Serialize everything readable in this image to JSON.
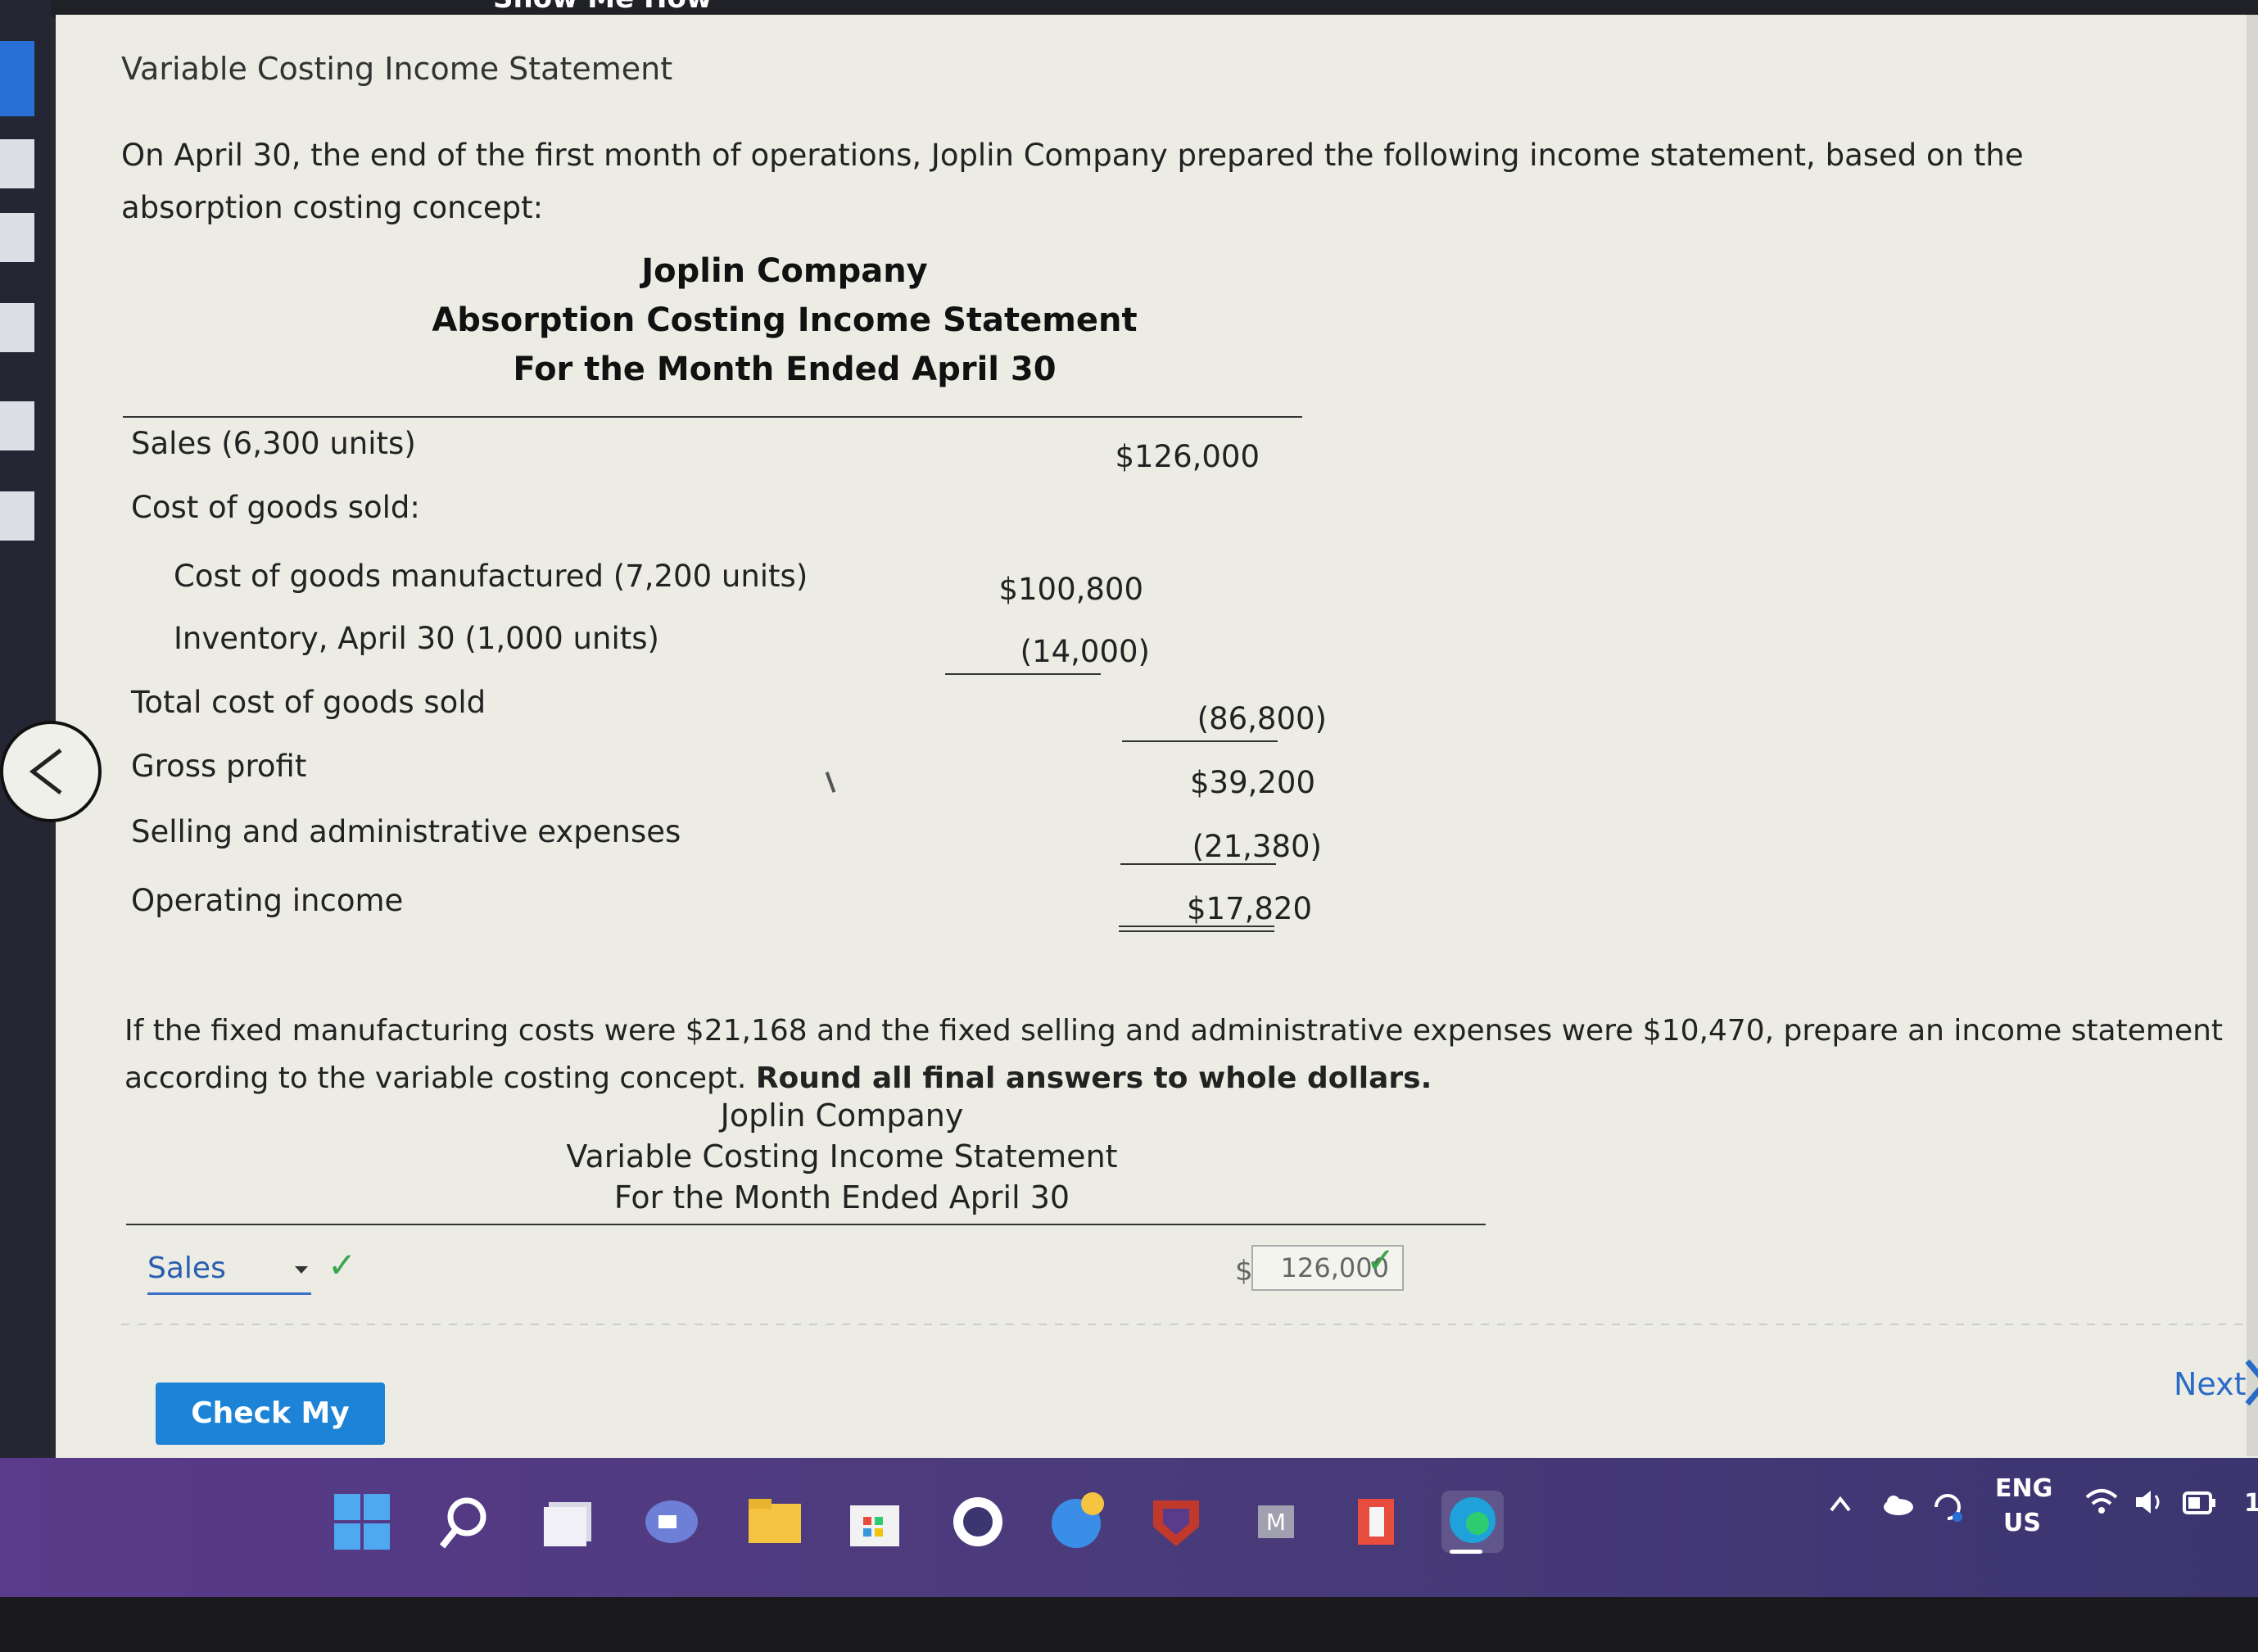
{
  "window": {
    "top_title_fragment": "Show Me How"
  },
  "problem": {
    "heading": "Variable Costing Income Statement",
    "intro": "On April 30, the end of the first month of operations, Joplin Company prepared the following income statement, based on the absorption costing concept:"
  },
  "absorption_statement": {
    "company": "Joplin Company",
    "title": "Absorption Costing Income Statement",
    "period": "For the Month Ended April 30",
    "rows": {
      "sales_label": "Sales (6,300 units)",
      "sales_value": "$126,000",
      "cogs_label": "Cost of goods sold:",
      "cogm_label": "Cost of goods manufactured (7,200 units)",
      "cogm_value": "$100,800",
      "inventory_label": "Inventory, April 30 (1,000 units)",
      "inventory_value": "(14,000)",
      "total_cogs_label": "Total cost of goods sold",
      "total_cogs_value": "(86,800)",
      "gross_profit_label": "Gross profit",
      "gross_profit_value": "$39,200",
      "sga_label": "Selling and administrative expenses",
      "sga_value": "(21,380)",
      "operating_income_label": "Operating income",
      "operating_income_value": "$17,820"
    }
  },
  "question": {
    "text": "If the fixed manufacturing costs were $21,168 and the fixed selling and administrative expenses were $10,470, prepare an income statement according to the variable costing concept.",
    "bold": "Round all final answers to whole dollars."
  },
  "variable_statement": {
    "company": "Joplin Company",
    "title": "Variable Costing Income Statement",
    "period": "For the Month Ended April 30",
    "first_row": {
      "select_value": "Sales",
      "check_mark": "✓",
      "currency_prefix": "$",
      "input_value": "126,000"
    }
  },
  "buttons": {
    "check_my_work": "Check My Work",
    "next": "Next"
  },
  "taskbar": {
    "lang_line1": "ENG",
    "lang_line2": "US",
    "time_fragment": "1"
  },
  "colors": {
    "page_bg": "#ecece4",
    "accent_blue": "#1c83d6",
    "check_green": "#3aa64a",
    "taskbar_purple": "#5a3a8a"
  }
}
